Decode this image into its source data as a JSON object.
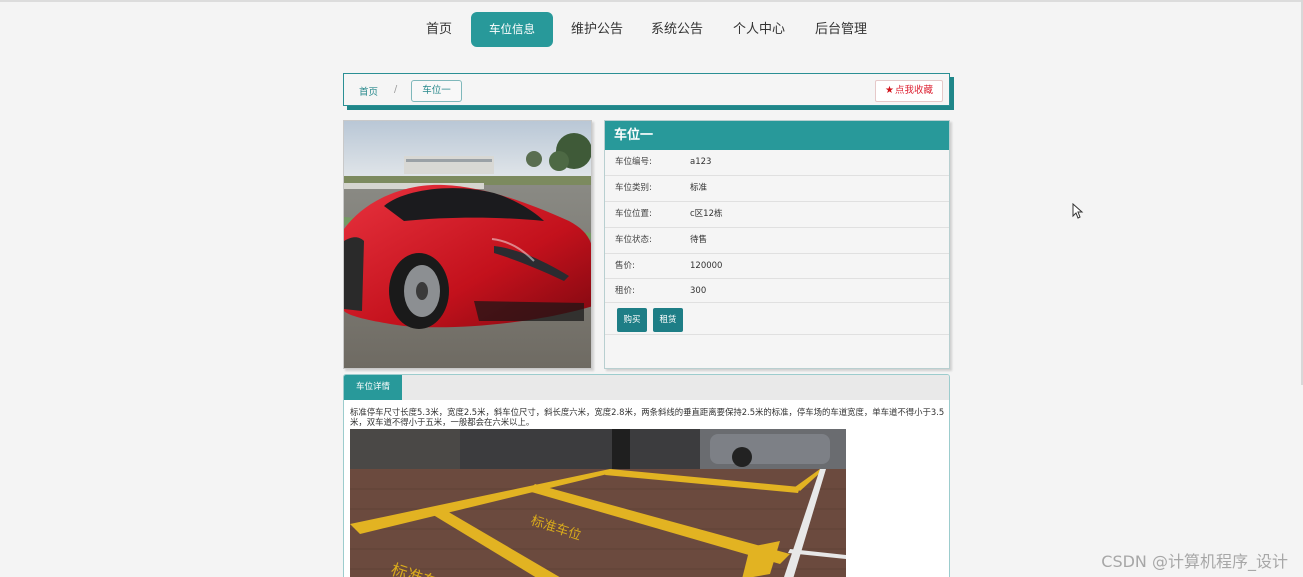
{
  "nav": {
    "items": [
      "首页",
      "车位信息",
      "维护公告",
      "系统公告",
      "个人中心",
      "后台管理"
    ],
    "active_index": 1
  },
  "breadcrumb": {
    "home": "首页",
    "separator": "/",
    "current": "车位一"
  },
  "favorite": {
    "label": "点我收藏",
    "icon": "star-icon"
  },
  "detail_card": {
    "title": "车位一",
    "fields": [
      {
        "label": "车位编号:",
        "value": "a123"
      },
      {
        "label": "车位类别:",
        "value": "标准"
      },
      {
        "label": "车位位置:",
        "value": "c区12栋"
      },
      {
        "label": "车位状态:",
        "value": "待售"
      },
      {
        "label": "售价:",
        "value": "120000"
      },
      {
        "label": "租价:",
        "value": "300"
      }
    ],
    "buttons": {
      "buy": "购买",
      "rent": "租赁"
    }
  },
  "detail_section": {
    "tab_label": "车位详情",
    "text": "标准停车尺寸长度5.3米，宽度2.5米，斜车位尺寸，斜长度六米，宽度2.8米，两条斜线的垂直距离要保持2.5米的标准，停车场的车道宽度，单车道不得小于3.5米，双车道不得小于五米，一般都会在六米以上。"
  },
  "watermark": "CSDN @计算机程序_设计",
  "colors": {
    "accent": "#28999a",
    "button": "#1e7e86",
    "star": "#d2141c"
  }
}
